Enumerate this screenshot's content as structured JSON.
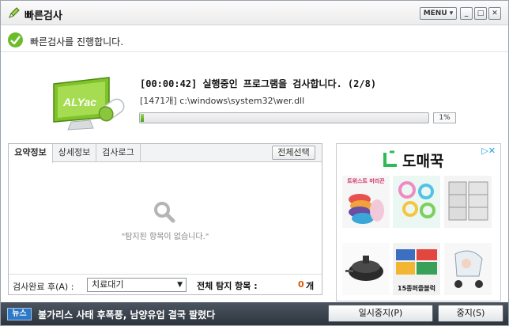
{
  "window": {
    "title": "빠른검사",
    "menu_label": "MENU",
    "min_icon": "minimize-icon",
    "max_icon": "maximize-icon",
    "close_icon": "close-icon"
  },
  "status": {
    "text": "빠른검사를 진행합니다.",
    "icon": "check-icon",
    "color": "#6cbb2b"
  },
  "scan": {
    "line1": "[00:00:42] 실행중인 프로그램을 검사합니다. (2/8)",
    "line2": "[1471개] c:\\windows\\system32\\wer.dll",
    "progress_percent": 1,
    "progress_label": "1%",
    "logo_text": "ALYac"
  },
  "results": {
    "tabs": [
      "요약정보",
      "상세정보",
      "검사로그"
    ],
    "active_tab": 0,
    "select_all_label": "전체선택",
    "empty_text": "\"탐지된 항목이 없습니다.\"",
    "after_label": "검사완료 후(A) :",
    "after_value": "치료대기",
    "total_label": "전체 탐지 항목 :",
    "total_count": "0",
    "total_unit": "개"
  },
  "ad": {
    "adchoices_icon": "adchoices-icon",
    "brand_name": "도매꾹",
    "items": [
      {
        "caption": "트위스트 머리끈",
        "caption2": ""
      },
      {
        "caption": "",
        "caption2": ""
      },
      {
        "caption": "",
        "caption2": ""
      },
      {
        "caption": "",
        "caption2": ""
      },
      {
        "caption": "",
        "caption2": "15종퍼즐블럭"
      },
      {
        "caption": "",
        "caption2": ""
      }
    ]
  },
  "bottom": {
    "news_badge": "뉴스",
    "news_text": "불가리스 사태 후폭풍, 남양유업 결국 팔렸다",
    "pause_label": "일시중지(P)",
    "stop_label": "중지(S)"
  }
}
